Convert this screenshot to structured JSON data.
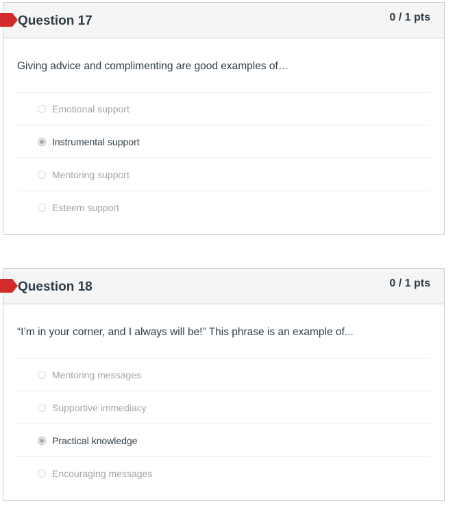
{
  "questions": [
    {
      "title": "Question 17",
      "points": "0 / 1 pts",
      "text": "Giving advice and complimenting are good examples of…",
      "answers": [
        {
          "label": "Emotional support",
          "selected": false
        },
        {
          "label": "Instrumental support",
          "selected": true
        },
        {
          "label": "Mentoring support",
          "selected": false
        },
        {
          "label": "Esteem support",
          "selected": false
        }
      ]
    },
    {
      "title": "Question 18",
      "points": "0 / 1 pts",
      "text": "“I’m in your corner, and I always will be!” This phrase is an example of...",
      "answers": [
        {
          "label": "Mentoring messages",
          "selected": false
        },
        {
          "label": "Supportive immediacy",
          "selected": false
        },
        {
          "label": "Practical knowledge",
          "selected": true
        },
        {
          "label": "Encouraging messages",
          "selected": false
        }
      ]
    }
  ],
  "colors": {
    "flag": "#d22b2b",
    "header_bg": "#f5f5f5",
    "text": "#2d3b45",
    "muted_text": "#a0a5a9"
  }
}
